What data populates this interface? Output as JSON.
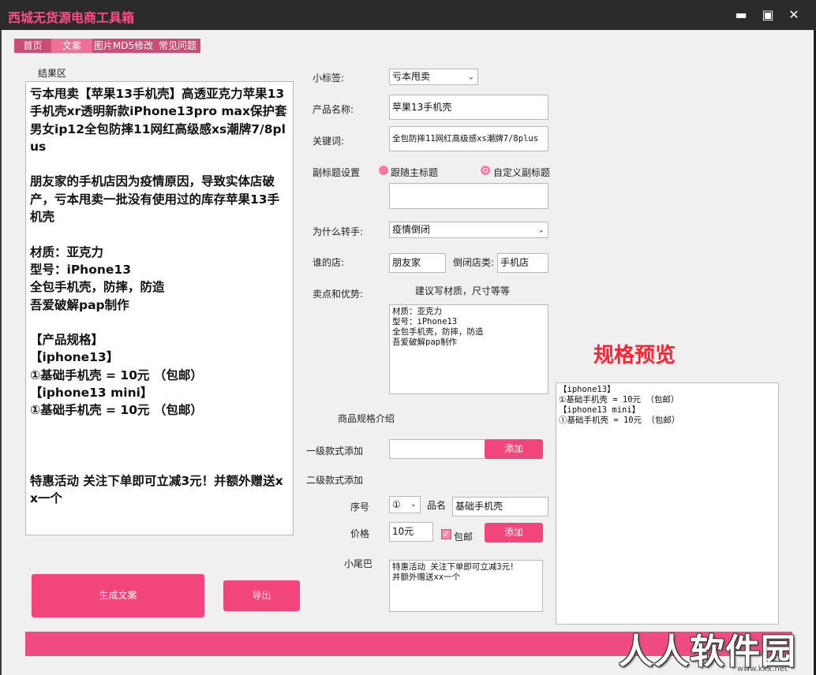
{
  "window": {
    "title": "西城无货源电商工具箱",
    "minimize": "▬",
    "maximize": "▣",
    "close": "✕"
  },
  "tabs": [
    {
      "label": "首页",
      "active": false
    },
    {
      "label": "文案",
      "active": true
    },
    {
      "label": "图片MD5修改",
      "active": false
    },
    {
      "label": "常见问题",
      "active": false
    }
  ],
  "result": {
    "label": "结果区",
    "text": "亏本甩卖【苹果13手机壳】高透亚克力苹果13手机壳xr透明新款iPhone13pro max保护套男女ip12全包防摔11网红高级感xs潮牌7/8plus\n\n朋友家的手机店因为疫情原因，导致实体店破产，亏本甩卖一批没有使用过的库存苹果13手机壳\n\n材质：亚克力\n型号：iPhone13\n全包手机壳，防摔，防造\n吾爱破解pap制作\n\n【产品规格】\n【iphone13】\n①基础手机壳 = 10元 （包邮）\n【iphone13 mini】\n①基础手机壳 = 10元 （包邮）\n\n\n\n特惠活动 关注下单即可立减3元！并额外赠送xx一个"
  },
  "buttons": {
    "generate": "生成文案",
    "export": "导出",
    "add_level1": "添加",
    "add_level2": "添加"
  },
  "form": {
    "tag_label": "小标签:",
    "tag_value": "亏本甩卖",
    "name_label": "产品名称:",
    "name_value": "苹果13手机壳",
    "keywords_label": "关键词:",
    "keywords_value": "全包防摔11网红高级感xs潮牌7/8plus",
    "subtitle_label": "副标题设置",
    "subtitle_opt1": "跟随主标题",
    "subtitle_opt2": "自定义副标题",
    "subtitle_value": "",
    "why_label": "为什么转手:",
    "why_value": "疫情倒闭",
    "whose_label": "谁的店:",
    "whose_value": "朋友家",
    "closed_label": "倒闭店类:",
    "closed_value": "手机店",
    "selling_label": "卖点和优势:",
    "selling_hint": "建议写材质，尺寸等等",
    "selling_text": "材质：亚克力\n型号：iPhone13\n全包手机壳，防摔，防造\n吾爱破解pap制作",
    "spec_title": "商品规格介绍",
    "level1_label": "一级款式添加",
    "level1_value": "",
    "level2_label": "二级款式添加",
    "seq_label": "序号",
    "seq_value": "①",
    "pname_label": "品名",
    "pname_value": "基础手机壳",
    "price_label": "价格",
    "price_value": "10元",
    "freeship_label": "包邮",
    "freeship_checked": true,
    "tail_label": "小尾巴",
    "tail_text": "特惠活动 关注下单即可立减3元！\n并额外赠送xx一个"
  },
  "preview": {
    "heading": "规格预览",
    "text": "【iphone13】\n①基础手机壳 = 10元 （包邮）\n【iphone13 mini】\n①基础手机壳 = 10元 （包邮）"
  },
  "watermark": {
    "text": "人人软件园",
    "url": "www.kkx.net"
  },
  "colors": {
    "accent": "#f2457c",
    "titlebar": "#2b2b2b",
    "title_text": "#ff4d86",
    "preview_heading": "#ff2233"
  }
}
